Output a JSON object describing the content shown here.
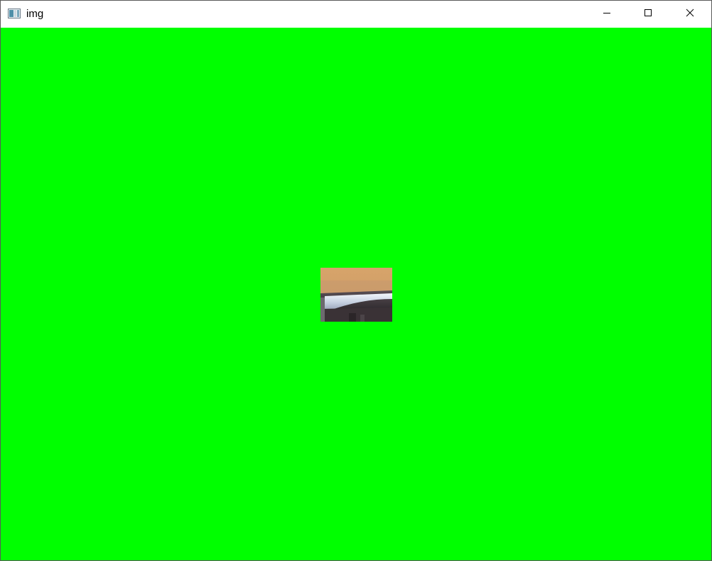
{
  "window": {
    "title": "img",
    "icon": "app-image-icon",
    "controls": {
      "minimize": "minimize-icon",
      "maximize": "maximize-icon",
      "close": "close-icon"
    }
  },
  "canvas": {
    "background": "#00ff00",
    "image": {
      "description_icon": "image-thumbnail"
    }
  }
}
